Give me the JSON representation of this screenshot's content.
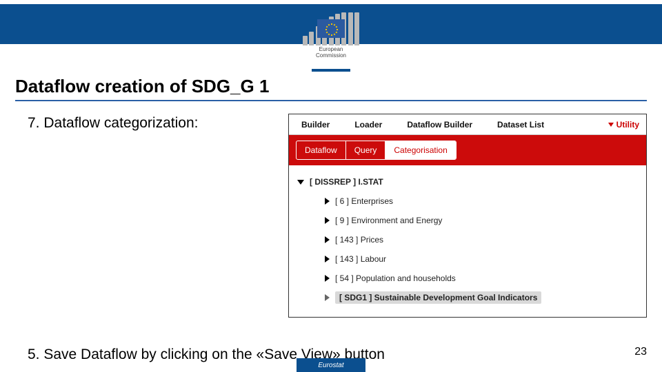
{
  "header": {
    "org_line1": "European",
    "org_line2": "Commission"
  },
  "slide": {
    "title": "Dataflow creation of SDG_G 1",
    "step7": "7. Dataflow categorization:",
    "step5": "5. Save Dataflow by clicking on the «Save View» button"
  },
  "screenshot": {
    "nav": {
      "builder": "Builder",
      "loader": "Loader",
      "dataflow_builder": "Dataflow Builder",
      "dataset_list": "Dataset List",
      "utility": "Utility"
    },
    "tabs": {
      "dataflow": "Dataflow",
      "query": "Query",
      "categorisation": "Categorisation"
    },
    "tree": {
      "root": "[ DISSREP ] I.STAT",
      "items": [
        "[ 6 ] Enterprises",
        "[ 9 ] Environment and Energy",
        "[ 143 ] Prices",
        "[ 143 ] Labour",
        "[ 54 ] Population and households"
      ],
      "selected": "[ SDG1 ] Sustainable Development Goal Indicators"
    }
  },
  "page_number": "23",
  "footer": "Eurostat"
}
